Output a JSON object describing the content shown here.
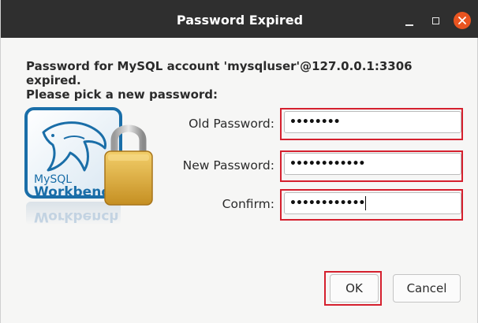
{
  "window": {
    "title": "Password Expired",
    "buttons": [
      "minimize-icon",
      "maximize-icon",
      "close-icon"
    ],
    "close_color": "#e95420"
  },
  "message": {
    "line1": "Password for MySQL account 'mysqluser'@127.0.0.1:3306 expired.",
    "line2": "Please pick a new password:"
  },
  "logo": {
    "brand_top": "MySQL",
    "brand_bottom": "Workbench",
    "reflection": "Workbench",
    "icon": "mysql-workbench-lock-logo"
  },
  "form": {
    "old_password": {
      "label": "Old Password:",
      "value": "••••••••"
    },
    "new_password": {
      "label": "New Password:",
      "value": "••••••••••••"
    },
    "confirm": {
      "label": "Confirm:",
      "value": "••••••••••••"
    }
  },
  "actions": {
    "ok_label": "OK",
    "cancel_label": "Cancel"
  },
  "colors": {
    "titlebar": "#2f2f2f",
    "highlight": "#d5202e",
    "logo_blue": "#1a6ea8"
  }
}
